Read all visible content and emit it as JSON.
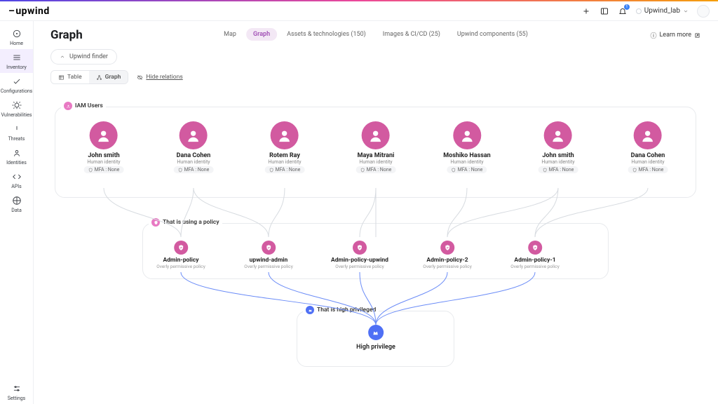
{
  "brand": "upwind",
  "header": {
    "notification_count": "1",
    "workspace_name": "Upwind_lab"
  },
  "sidebar": {
    "items": [
      {
        "label": "Home",
        "icon": "home"
      },
      {
        "label": "Inventory",
        "icon": "inventory",
        "active": true
      },
      {
        "label": "Configurations",
        "icon": "check"
      },
      {
        "label": "Vulnerabilities",
        "icon": "bug"
      },
      {
        "label": "Threats",
        "icon": "alert"
      },
      {
        "label": "Identities",
        "icon": "identity"
      },
      {
        "label": "APIs",
        "icon": "api"
      },
      {
        "label": "Data",
        "icon": "data"
      }
    ],
    "footer": {
      "label": "Settings",
      "icon": "settings"
    }
  },
  "page": {
    "title": "Graph",
    "learn_more": "Learn more"
  },
  "tabs": [
    {
      "label": "Map"
    },
    {
      "label": "Graph",
      "active": true
    },
    {
      "label": "Assets & technologies (150)"
    },
    {
      "label": "Images & CI/CD (25)"
    },
    {
      "label": "Upwind components (55)"
    }
  ],
  "finder_label": "Upwind finder",
  "view": {
    "table_label": "Table",
    "graph_label": "Graph",
    "hide_relations": "Hide relations"
  },
  "groups": {
    "users_label": "IAM Users",
    "policies_label": "That is using a policy",
    "priv_label": "That is high privileged"
  },
  "users": [
    {
      "name": "John smith",
      "sub": "Human identity",
      "mfa": "MFA : None"
    },
    {
      "name": "Dana Cohen",
      "sub": "Human identity",
      "mfa": "MFA : None"
    },
    {
      "name": "Rotem Ray",
      "sub": "Human identity",
      "mfa": "MFA : None"
    },
    {
      "name": "Maya Mitrani",
      "sub": "Human identity",
      "mfa": "MFA : None"
    },
    {
      "name": "Moshiko Hassan",
      "sub": "Human identity",
      "mfa": "MFA : None"
    },
    {
      "name": "John smith",
      "sub": "Human identity",
      "mfa": "MFA : None"
    },
    {
      "name": "Dana Cohen",
      "sub": "Human identity",
      "mfa": "MFA : None"
    }
  ],
  "policies": [
    {
      "name": "Admin-policy",
      "sub": "Overly permissive policy"
    },
    {
      "name": "upwind-admin",
      "sub": "Overly permissive policy"
    },
    {
      "name": "Admin-policy-upwind",
      "sub": "Overly permissive policy"
    },
    {
      "name": "Admin-policy-2",
      "sub": "Overly permissive policy"
    },
    {
      "name": "Admin-policy-1",
      "sub": "Overly permissive policy"
    }
  ],
  "privilege": {
    "name": "High privilege"
  }
}
